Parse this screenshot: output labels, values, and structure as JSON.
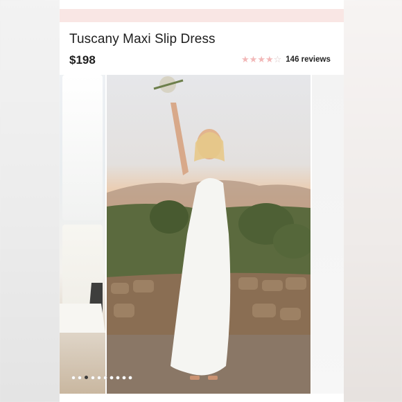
{
  "product": {
    "title": "Tuscany Maxi Slip Dress",
    "price": "$198",
    "rating": {
      "value": 4,
      "max": 5,
      "reviews_text": "146 reviews"
    }
  },
  "gallery": {
    "image_count": 10,
    "active_index": 2,
    "main_image_icon": "product-photo"
  },
  "colors": {
    "accent_strip": "#f9e6e4",
    "star_filled": "#f2b8b8",
    "text": "#1d1d1d"
  }
}
